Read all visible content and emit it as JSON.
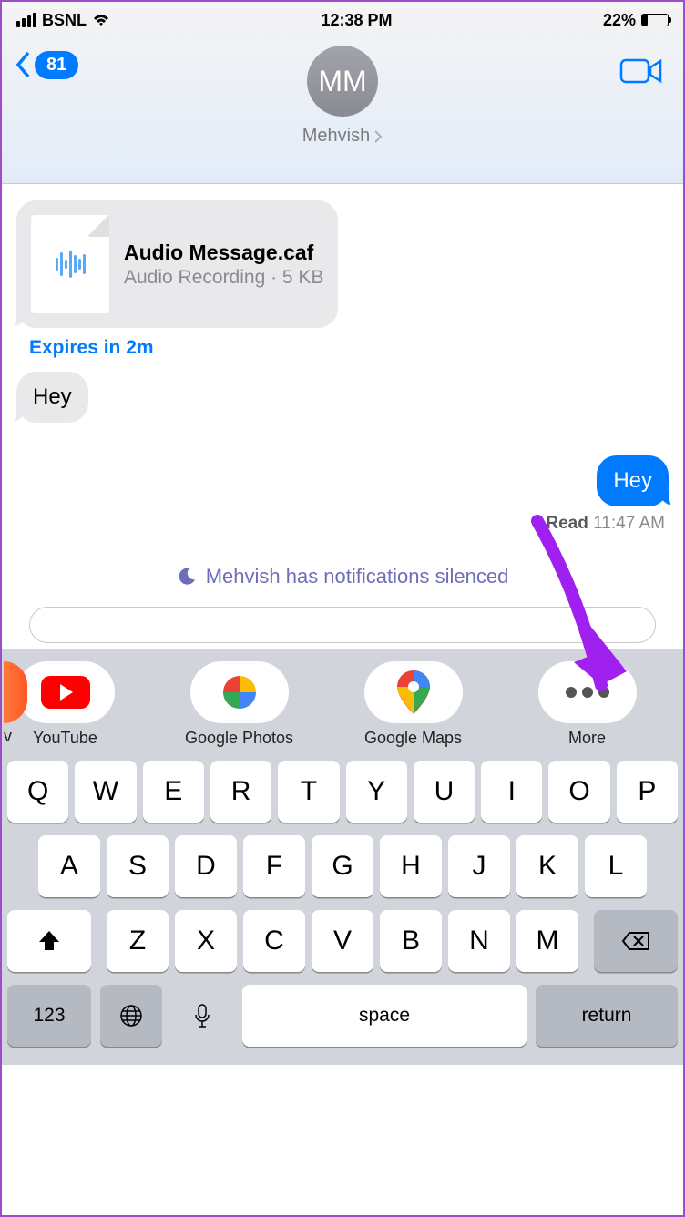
{
  "status": {
    "carrier": "BSNL",
    "time": "12:38 PM",
    "battery_pct": "22%"
  },
  "nav": {
    "back_count": "81",
    "avatar_initials": "MM",
    "contact_name": "Mehvish"
  },
  "messages": {
    "audio": {
      "title": "Audio Message.caf",
      "subtitle": "Audio Recording · 5 KB"
    },
    "expires": "Expires in 2m",
    "received_text": "Hey",
    "sent_text": "Hey",
    "read_label": "Read",
    "read_time": "11:47 AM"
  },
  "dnd": "Mehvish has notifications silenced",
  "apps": {
    "partial_label": "v",
    "youtube": "YouTube",
    "photos": "Google Photos",
    "maps": "Google Maps",
    "more": "More"
  },
  "keys": {
    "row1": [
      "Q",
      "W",
      "E",
      "R",
      "T",
      "Y",
      "U",
      "I",
      "O",
      "P"
    ],
    "row2": [
      "A",
      "S",
      "D",
      "F",
      "G",
      "H",
      "J",
      "K",
      "L"
    ],
    "row3": [
      "Z",
      "X",
      "C",
      "V",
      "B",
      "N",
      "M"
    ],
    "numeric": "123",
    "space": "space",
    "return": "return"
  }
}
